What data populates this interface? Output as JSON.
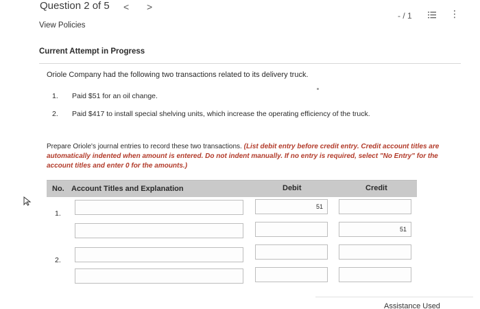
{
  "header": {
    "question_label": "Question 2 of 5",
    "prev_symbol": "<",
    "next_symbol": ">",
    "score": "- / 1",
    "more_symbol": "⋮"
  },
  "links": {
    "view_policies": "View Policies"
  },
  "attempt_status": "Current Attempt in Progress",
  "problem": {
    "intro": "Oriole Company had the following two transactions related to its delivery truck.",
    "items": [
      {
        "num": "1.",
        "text": "Paid $51 for an oil change."
      },
      {
        "num": "2.",
        "text": "Paid $417 to install special shelving units, which increase the operating efficiency of the truck."
      }
    ]
  },
  "instructions": {
    "plain": "Prepare Oriole's journal entries to record these two transactions. ",
    "emphasis": "(List debit entry before credit entry. Credit account titles are automatically indented when amount is entered. Do not indent manually. If no entry is required, select \"No Entry\" for the account titles and enter 0 for the amounts.)"
  },
  "table": {
    "headers": {
      "no": "No.",
      "account": "Account Titles and Explanation",
      "debit": "Debit",
      "credit": "Credit"
    },
    "entries": [
      {
        "num": "1.",
        "lines": [
          {
            "account": "",
            "debit": "51",
            "credit": ""
          },
          {
            "account": "",
            "debit": "",
            "credit": "51"
          }
        ]
      },
      {
        "num": "2.",
        "lines": [
          {
            "account": "",
            "debit": "",
            "credit": ""
          },
          {
            "account": "",
            "debit": "",
            "credit": ""
          }
        ]
      }
    ]
  },
  "footer": {
    "assistance": "Assistance Used"
  },
  "colors": {
    "header_bg": "#c9c9c9",
    "emphasis_text": "#b23b2a"
  }
}
